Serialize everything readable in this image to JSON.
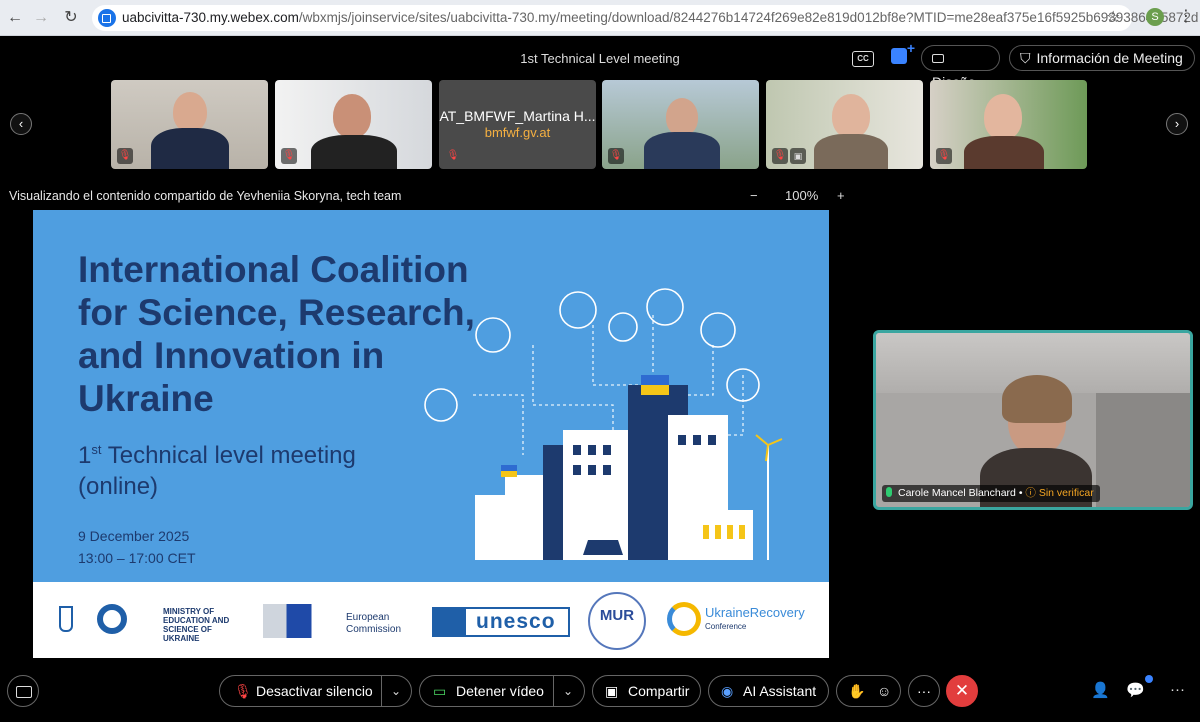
{
  "browser": {
    "url_host": "uabcivitta-730.my.webex.com",
    "url_path": "/wbxmjs/joinservice/sites/uabcivitta-730.my/meeting/download/8244276b14724f269e82e819d012bf8e?MTID=me28eaf375e16f5925b69393864a5872d",
    "profile_initial": "S"
  },
  "header": {
    "meeting_title": "1st Technical Level meeting",
    "layout_label": "Diseño",
    "info_label": "Información de Meeting",
    "cc_label": "CC"
  },
  "participants": [
    {
      "name": "",
      "muted": true
    },
    {
      "name": "",
      "muted": true
    },
    {
      "name": "AT_BMFWF_Martina H...",
      "sub": "bmfwf.gv.at",
      "muted": true
    },
    {
      "name": "",
      "muted": true
    },
    {
      "name": "",
      "muted": true,
      "sharing": true
    },
    {
      "name": "",
      "muted": true
    }
  ],
  "share": {
    "viewing_text": "Visualizando el contenido compartido de Yevheniia Skoryna, tech team",
    "zoom_level": "100%",
    "zoom_minus": "−",
    "zoom_plus": "+"
  },
  "slide": {
    "title": "International Coalition for Science, Research, and Innovation in Ukraine",
    "sub_prefix": "1",
    "sub_sup": "st",
    "sub_rest": " Technical level meeting (online)",
    "date_line1": "9 December 2025",
    "date_line2": "13:00 – 17:00 CET",
    "logos": {
      "ministry": "MINISTRY OF EDUCATION AND SCIENCE OF UKRAINE",
      "ec_line1": "European",
      "ec_line2": "Commission",
      "unesco": "unesco",
      "mur": "MUR",
      "urc_line1": "UkraineRecovery",
      "urc_line2": "Conference"
    }
  },
  "self_view": {
    "name": "Carole Mancel Blanchard",
    "status": "Sin verificar"
  },
  "controls": {
    "mute_label": "Desactivar silencio",
    "video_label": "Detener vídeo",
    "share_label": "Compartir",
    "ai_label": "AI Assistant",
    "more_label": "···",
    "end_label": "✕"
  },
  "colors": {
    "slide_bg": "#4f9ee0",
    "slide_text": "#1d3a6e",
    "end_red": "#e23d3d",
    "accent_blue": "#3a83ff",
    "self_border": "#3aa6a0"
  }
}
